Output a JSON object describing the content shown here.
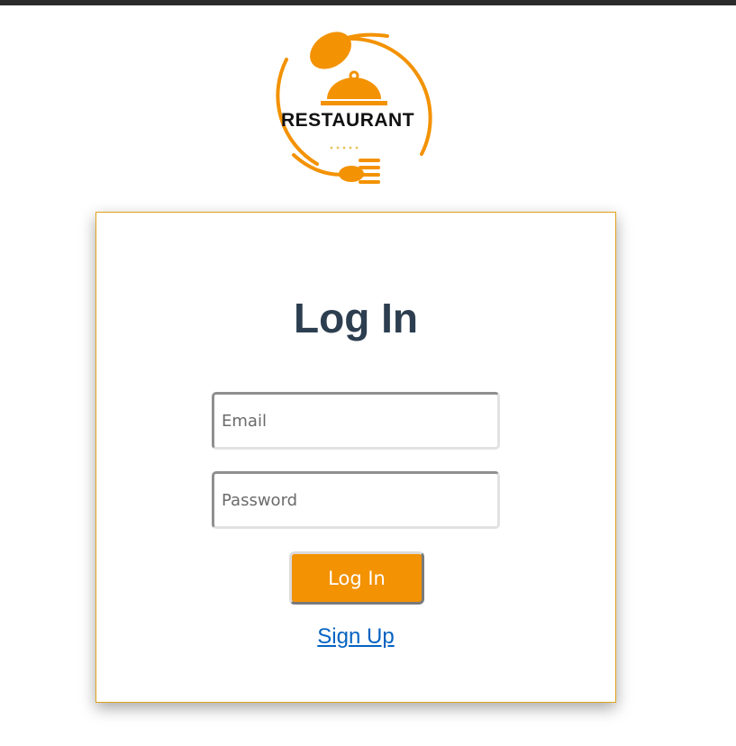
{
  "logo": {
    "text": "RESTAURANT",
    "accent_color": "#f39203"
  },
  "login": {
    "title": "Log In",
    "email_placeholder": "Email",
    "password_placeholder": "Password",
    "button_label": "Log In",
    "signup_label": "Sign Up"
  },
  "colors": {
    "button": "#f39203",
    "card_border": "#e0a21a",
    "title": "#2c3e50",
    "link": "#0563c1"
  }
}
